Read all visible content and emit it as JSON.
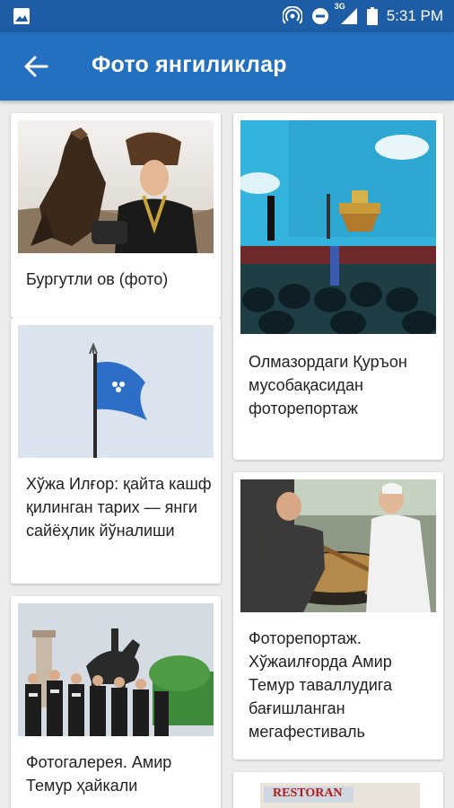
{
  "status": {
    "time": "5:31 PM",
    "network": "3G"
  },
  "appbar": {
    "title": "Фото янгиликлар"
  },
  "cards": {
    "c1": "Бургутли ов (фото)",
    "c2": "Олмазордаги Қуръон мусобақасидан фоторепортаж",
    "c3": "Хўжа Илғор: қайта кашф қилинган тарих — янги сайёҳлик йўналиши",
    "c4": "Фоторепортаж. Хўжаилғорда Амир Темур таваллудига бағишланган мегафестиваль",
    "c5": "Фотогалерея. Амир Темур ҳайкали",
    "c6_sign": "RESTORAN"
  },
  "colors": {
    "statusbar": "#1c5da6",
    "appbar": "#2470c0",
    "background": "#ececec"
  }
}
